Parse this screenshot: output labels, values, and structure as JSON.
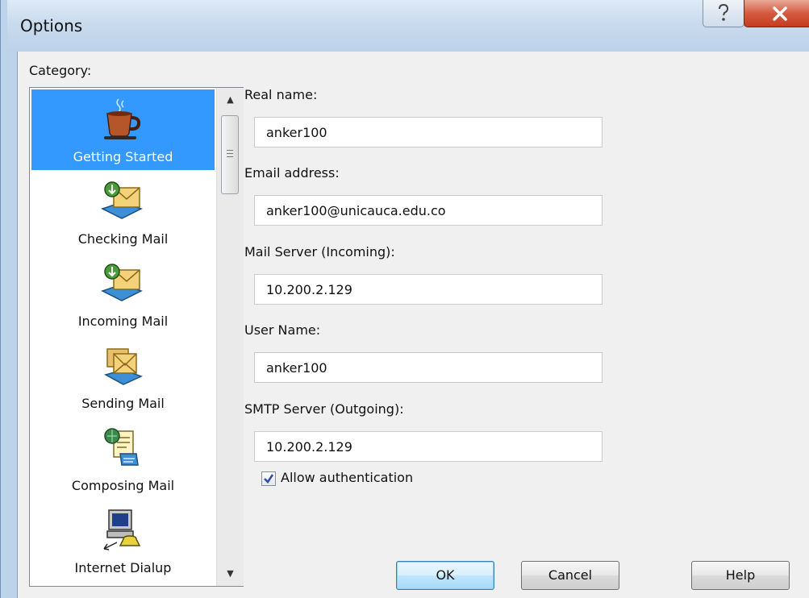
{
  "window": {
    "title": "Options",
    "help_glyph": "?",
    "close_glyph": "X"
  },
  "category": {
    "label": "Category:",
    "items": [
      {
        "label": "Getting Started",
        "icon": "coffee-cup-icon",
        "selected": true
      },
      {
        "label": "Checking Mail",
        "icon": "mail-download-icon",
        "selected": false
      },
      {
        "label": "Incoming Mail",
        "icon": "mail-inbox-icon",
        "selected": false
      },
      {
        "label": "Sending Mail",
        "icon": "mail-send-icon",
        "selected": false
      },
      {
        "label": "Composing Mail",
        "icon": "mail-compose-icon",
        "selected": false
      },
      {
        "label": "Internet Dialup",
        "icon": "computer-dialup-icon",
        "selected": false
      }
    ]
  },
  "form": {
    "real_name_label": "Real name:",
    "real_name_value": "anker100",
    "email_label": "Email address:",
    "email_value": "anker100@unicauca.edu.co",
    "incoming_label": "Mail Server (Incoming):",
    "incoming_value": "10.200.2.129",
    "username_label": "User Name:",
    "username_value": "anker100",
    "smtp_label": "SMTP Server (Outgoing):",
    "smtp_value": "10.200.2.129",
    "allow_auth_label": "Allow authentication",
    "allow_auth_checked": true
  },
  "buttons": {
    "ok": "OK",
    "cancel": "Cancel",
    "help": "Help"
  },
  "colors": {
    "selection": "#3399ff",
    "close_button": "#c43c1f"
  }
}
